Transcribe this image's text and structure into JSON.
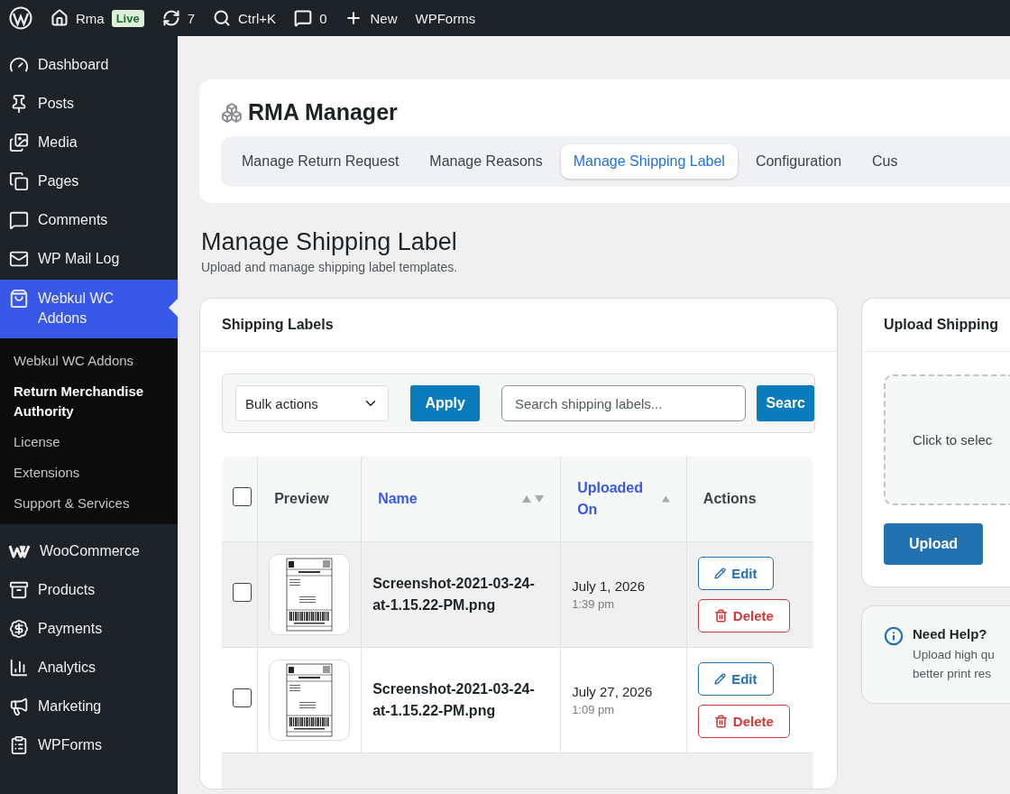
{
  "admin_bar": [
    {
      "kind": "logo"
    },
    {
      "kind": "site",
      "label": "Rma",
      "badge": "Live"
    },
    {
      "kind": "updates",
      "label": "7"
    },
    {
      "kind": "search",
      "label": "Ctrl+K"
    },
    {
      "kind": "comments",
      "label": "0"
    },
    {
      "kind": "new",
      "label": "New"
    },
    {
      "kind": "text",
      "label": "WPForms"
    }
  ],
  "sidebar": {
    "items": [
      {
        "kind": "dashboard",
        "label": "Dashboard",
        "selected": false
      },
      {
        "kind": "posts",
        "label": "Posts",
        "selected": false
      },
      {
        "kind": "media",
        "label": "Media",
        "selected": false
      },
      {
        "kind": "pages",
        "label": "Pages",
        "selected": false
      },
      {
        "kind": "comments",
        "label": "Comments",
        "selected": false
      },
      {
        "kind": "mail",
        "label": "WP Mail Log",
        "selected": false
      },
      {
        "kind": "webkul",
        "label": "Webkul WC Addons",
        "selected": true,
        "children": [
          {
            "label": "Webkul WC Addons",
            "selected": false
          },
          {
            "label": "Return Merchandise Authority",
            "selected": true
          },
          {
            "label": "License",
            "selected": false
          },
          {
            "label": "Extensions",
            "selected": false
          },
          {
            "label": "Support & Services",
            "selected": false
          }
        ]
      },
      {
        "kind": "woocommerce",
        "label": "WooCommerce",
        "selected": false
      },
      {
        "kind": "products",
        "label": "Products",
        "selected": false
      },
      {
        "kind": "payments",
        "label": "Payments",
        "selected": false
      },
      {
        "kind": "analytics",
        "label": "Analytics",
        "selected": false
      },
      {
        "kind": "marketing",
        "label": "Marketing",
        "selected": false
      },
      {
        "kind": "forms",
        "label": "WPForms",
        "selected": false
      }
    ]
  },
  "plugin": {
    "title": "RMA Manager",
    "tabs": [
      {
        "label": "Manage Return Request",
        "selected": false
      },
      {
        "label": "Manage Reasons",
        "selected": false
      },
      {
        "label": "Manage Shipping Label",
        "selected": true
      },
      {
        "label": "Configuration",
        "selected": false
      },
      {
        "label": "Cus",
        "selected": false
      }
    ]
  },
  "page": {
    "title": "Manage Shipping Label",
    "description": "Upload and manage shipping label templates."
  },
  "labels_panel": {
    "title": "Shipping Labels",
    "bulk_actions": {
      "value": "Bulk actions"
    },
    "apply_button": "Apply",
    "search": {
      "placeholder": "Search shipping labels..."
    },
    "search_button": "Searc",
    "table": {
      "select_all": {
        "checked": false
      },
      "columns": [
        {
          "label": "Preview",
          "kind": "plain"
        },
        {
          "label": "Name",
          "kind": "sortable"
        },
        {
          "label": "Uploaded On",
          "kind": "sorted-asc"
        },
        {
          "label": "Actions",
          "kind": "plain"
        }
      ],
      "rows": [
        {
          "checked": false,
          "hovered": true,
          "name": "Screenshot-2021-03-24-at-1.15.22-PM.png",
          "date": "July 1, 2026",
          "time": "1:39 pm",
          "edit": "Edit",
          "delete": "Delete"
        },
        {
          "checked": false,
          "hovered": false,
          "name": "Screenshot-2021-03-24-at-1.15.22-PM.png",
          "date": "July 27, 2026",
          "time": "1:09 pm",
          "edit": "Edit",
          "delete": "Delete"
        }
      ]
    }
  },
  "upload_panel": {
    "title": "Upload Shipping",
    "dropzone": "Click to selec",
    "button": "Upload"
  },
  "help": {
    "title": "Need Help?",
    "lines": [
      "Upload high qu",
      "better print res"
    ]
  }
}
